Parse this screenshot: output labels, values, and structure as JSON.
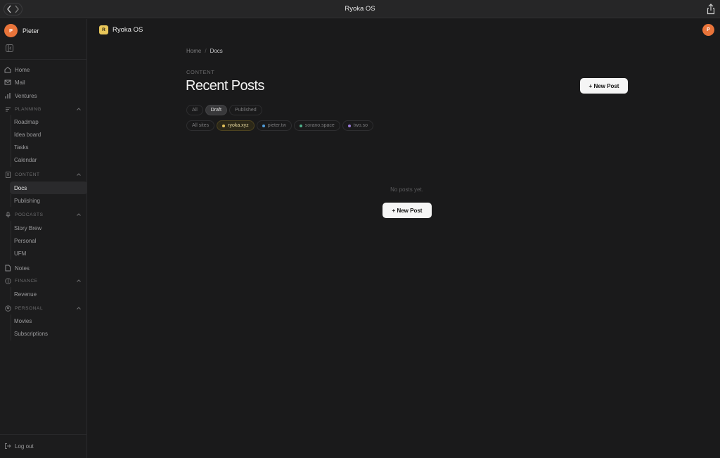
{
  "window": {
    "title": "Ryoka OS"
  },
  "user": {
    "initial": "P",
    "name": "Pieter"
  },
  "sidebar": {
    "nav": [
      {
        "label": "Home",
        "icon": "home-icon"
      },
      {
        "label": "Mail",
        "icon": "mail-icon"
      },
      {
        "label": "Ventures",
        "icon": "chart-icon"
      }
    ],
    "groups": [
      {
        "label": "PLANNING",
        "icon": "layers-icon",
        "items": [
          "Roadmap",
          "Idea board",
          "Tasks",
          "Calendar"
        ]
      },
      {
        "label": "CONTENT",
        "icon": "document-icon",
        "items": [
          "Docs",
          "Publishing"
        ]
      },
      {
        "label": "PODCASTS",
        "icon": "microphone-icon",
        "items": [
          "Story Brew",
          "Personal",
          "UFM"
        ]
      },
      {
        "label": "FINANCE",
        "icon": "dollar-icon",
        "items": [
          "Revenue"
        ]
      },
      {
        "label": "PERSONAL",
        "icon": "person-icon",
        "items": [
          "Movies",
          "Subscriptions"
        ]
      }
    ],
    "notes_label": "Notes",
    "active_item": "Docs",
    "logout_label": "Log out"
  },
  "brand": {
    "initial": "R",
    "name": "Ryoka OS"
  },
  "breadcrumb": {
    "home": "Home",
    "separator": "/",
    "current": "Docs"
  },
  "section_label": "CONTENT",
  "page_title": "Recent Posts",
  "new_post_label": "+ New Post",
  "status_tabs": [
    {
      "label": "All",
      "active": false
    },
    {
      "label": "Draft",
      "active": true
    },
    {
      "label": "Published",
      "active": false
    }
  ],
  "site_filters": [
    {
      "label": "All sites",
      "active": false
    },
    {
      "label": "ryoka.xyz",
      "active": true
    },
    {
      "label": "pieter.tw",
      "active": false
    },
    {
      "label": "sorano.space",
      "active": false
    },
    {
      "label": "two.so",
      "active": false
    }
  ],
  "empty_state": {
    "message": "No posts yet.",
    "button_label": "+ New Post"
  },
  "colors": {
    "accent_avatar": "#e9743a",
    "brand_badge": "#e9c75a",
    "dot_ryoka": "#e3c15a",
    "dot_pieter": "#4f9bd8",
    "dot_sorano": "#4fb08a",
    "dot_twoso": "#9a7ad8"
  }
}
